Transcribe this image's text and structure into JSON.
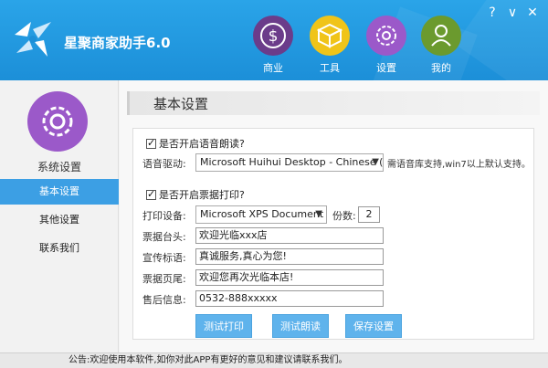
{
  "app": {
    "title": "星聚商家助手6.0"
  },
  "window_controls": {
    "help": "?",
    "minimize": "∨",
    "close": "✕"
  },
  "nav": [
    {
      "label": "商业",
      "color": "#6b3c8a",
      "icon": "dollar-icon"
    },
    {
      "label": "工具",
      "color": "#f0c419",
      "icon": "box-icon"
    },
    {
      "label": "设置",
      "color": "#9b59c9",
      "icon": "gear-icon"
    },
    {
      "label": "我的",
      "color": "#6b9a2e",
      "icon": "user-icon"
    }
  ],
  "sidebar": {
    "title": "系统设置",
    "items": [
      {
        "label": "基本设置",
        "active": true
      },
      {
        "label": "其他设置",
        "active": false
      },
      {
        "label": "联系我们",
        "active": false
      }
    ]
  },
  "main": {
    "section_title": "基本设置",
    "voice": {
      "checkbox_label": "是否开启语音朗读?",
      "driver_label": "语音驱动:",
      "driver_value": "Microsoft Huihui Desktop - Chinese (",
      "driver_note": "需语音库支持,win7以上默认支持。"
    },
    "print": {
      "checkbox_label": "是否开启票据打印?",
      "device_label": "打印设备:",
      "device_value": "Microsoft XPS Document",
      "copies_label": "份数:",
      "copies_value": "2",
      "header_label": "票据台头:",
      "header_value": "欢迎光临xxx店",
      "slogan_label": "宣传标语:",
      "slogan_value": "真诚服务,真心为您!",
      "footer_label": "票据页尾:",
      "footer_value": "欢迎您再次光临本店!",
      "aftersale_label": "售后信息:",
      "aftersale_value": "0532-888xxxxx"
    },
    "buttons": {
      "test_print": "测试打印",
      "test_read": "测试朗读",
      "save": "保存设置"
    }
  },
  "status": {
    "text": "公告:欢迎使用本软件,如你对此APP有更好的意见和建议请联系我们。"
  }
}
